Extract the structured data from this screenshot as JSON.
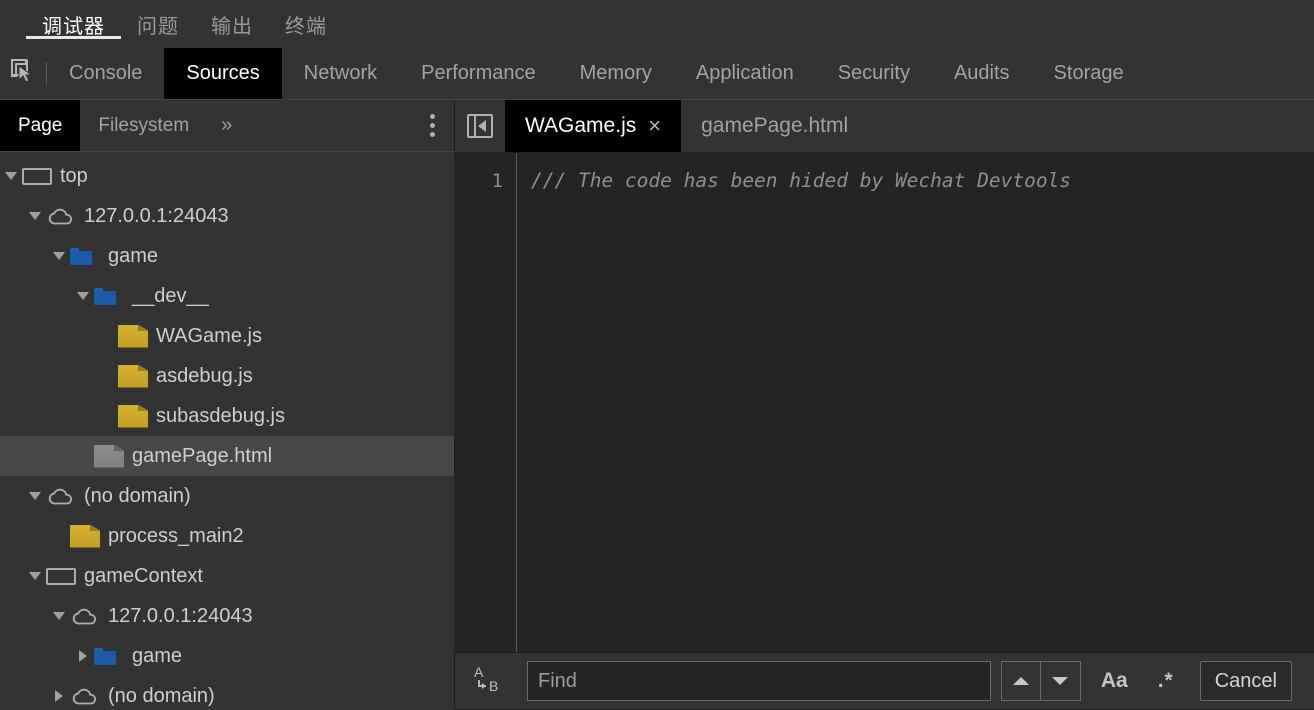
{
  "ide_tabs": [
    {
      "label": "调试器",
      "active": true
    },
    {
      "label": "问题",
      "active": false
    },
    {
      "label": "输出",
      "active": false
    },
    {
      "label": "终端",
      "active": false
    }
  ],
  "devtools": {
    "inspect_icon": "inspect-cursor-icon",
    "tabs": [
      {
        "label": "Console",
        "active": false
      },
      {
        "label": "Sources",
        "active": true
      },
      {
        "label": "Network",
        "active": false
      },
      {
        "label": "Performance",
        "active": false
      },
      {
        "label": "Memory",
        "active": false
      },
      {
        "label": "Application",
        "active": false
      },
      {
        "label": "Security",
        "active": false
      },
      {
        "label": "Audits",
        "active": false
      },
      {
        "label": "Storage",
        "active": false
      }
    ]
  },
  "navigator": {
    "tabs": [
      {
        "label": "Page",
        "active": true
      },
      {
        "label": "Filesystem",
        "active": false
      }
    ],
    "more_label": "»",
    "menu_icon": "kebab-menu-icon",
    "tree": [
      {
        "label": "top",
        "depth": 0,
        "twisty": "open",
        "icon": "frame",
        "selected": false
      },
      {
        "label": "127.0.0.1:24043",
        "depth": 1,
        "twisty": "open",
        "icon": "cloud",
        "selected": false
      },
      {
        "label": "game",
        "depth": 2,
        "twisty": "open",
        "icon": "folder",
        "selected": false
      },
      {
        "label": "__dev__",
        "depth": 3,
        "twisty": "open",
        "icon": "folder",
        "selected": false
      },
      {
        "label": "WAGame.js",
        "depth": 4,
        "twisty": "none",
        "icon": "file-js",
        "selected": false
      },
      {
        "label": "asdebug.js",
        "depth": 4,
        "twisty": "none",
        "icon": "file-js",
        "selected": false
      },
      {
        "label": "subasdebug.js",
        "depth": 4,
        "twisty": "none",
        "icon": "file-js",
        "selected": false
      },
      {
        "label": "gamePage.html",
        "depth": 3,
        "twisty": "none",
        "icon": "file-html",
        "selected": true
      },
      {
        "label": "(no domain)",
        "depth": 1,
        "twisty": "open",
        "icon": "cloud",
        "selected": false
      },
      {
        "label": "process_main2",
        "depth": 2,
        "twisty": "none",
        "icon": "file-js",
        "selected": false
      },
      {
        "label": "gameContext",
        "depth": 1,
        "twisty": "open",
        "icon": "frame",
        "selected": false
      },
      {
        "label": "127.0.0.1:24043",
        "depth": 2,
        "twisty": "open",
        "icon": "cloud",
        "selected": false
      },
      {
        "label": "game",
        "depth": 3,
        "twisty": "closed",
        "icon": "folder",
        "selected": false
      },
      {
        "label": "(no domain)",
        "depth": 2,
        "twisty": "closed",
        "icon": "cloud",
        "selected": false
      }
    ]
  },
  "editor": {
    "collapse_icon": "collapse-sidebar-icon",
    "tabs": [
      {
        "label": "WAGame.js",
        "active": true,
        "closable": true
      },
      {
        "label": "gamePage.html",
        "active": false,
        "closable": false
      }
    ],
    "close_glyph": "×",
    "lines": [
      {
        "number": "1",
        "text": "/// The code has been hided by Wechat Devtools"
      }
    ]
  },
  "find_bar": {
    "replace_icon": "replace-ab-icon",
    "find_placeholder": "Find",
    "find_value": "",
    "prev_icon": "chevron-up-icon",
    "next_icon": "chevron-down-icon",
    "match_case_label": "Aa",
    "regex_label": ".*",
    "cancel_label": "Cancel"
  },
  "colors": {
    "chrome_bg": "#333333",
    "editor_bg": "#242424",
    "active_tab_bg": "#000000",
    "selected_row_bg": "#474747",
    "folder_blue": "#1a5ba8",
    "file_yellow": "#d0a92b",
    "text_primary": "#ffffff",
    "text_secondary": "#a3a3a3"
  }
}
